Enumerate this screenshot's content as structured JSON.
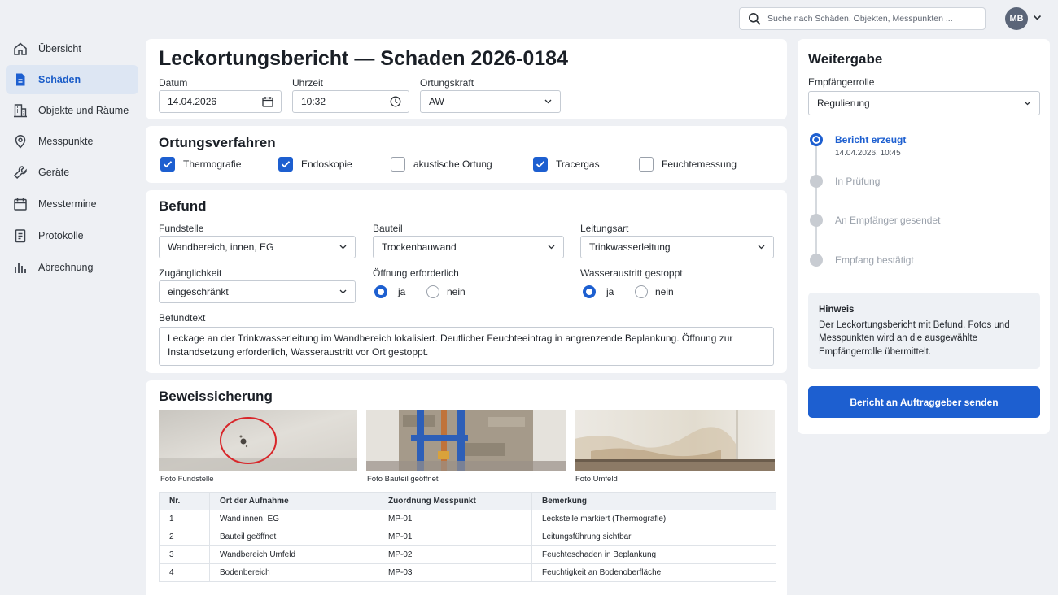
{
  "sidebar": {
    "items": [
      {
        "label": "Übersicht",
        "icon": "home-icon"
      },
      {
        "label": "Schäden",
        "icon": "document-icon",
        "active": true
      },
      {
        "label": "Objekte und Räume",
        "icon": "building-icon"
      },
      {
        "label": "Messpunkte",
        "icon": "map-pin-icon"
      },
      {
        "label": "Geräte",
        "icon": "wrench-icon"
      },
      {
        "label": "Messtermine",
        "icon": "calendar-icon"
      },
      {
        "label": "Protokolle",
        "icon": "clipboard-icon"
      },
      {
        "label": "Abrechnung",
        "icon": "bar-chart-icon"
      }
    ]
  },
  "topbar": {
    "search_placeholder": "Suche nach Schäden, Objekten, Messpunkten ...",
    "avatar_initials": "MB"
  },
  "report": {
    "title": "Leckortungsbericht — Schaden 2026-0184",
    "date_label": "Datum",
    "date_value": "14.04.2026",
    "time_label": "Uhrzeit",
    "time_value": "10:32",
    "technician_label": "Ortungskraft",
    "technician_value": "AW"
  },
  "methods": {
    "title": "Ortungsverfahren",
    "options": [
      {
        "label": "Thermografie",
        "checked": true
      },
      {
        "label": "Endoskopie",
        "checked": true
      },
      {
        "label": "akustische Ortung",
        "checked": false
      },
      {
        "label": "Tracergas",
        "checked": true
      },
      {
        "label": "Feuchtemessung",
        "checked": false
      }
    ]
  },
  "finding": {
    "title": "Befund",
    "location_label": "Fundstelle",
    "location_value": "Wandbereich, innen, EG",
    "component_label": "Bauteil",
    "component_value": "Trockenbauwand",
    "pipe_label": "Leitungsart",
    "pipe_value": "Trinkwasserleitung",
    "access_label": "Zugänglichkeit",
    "access_value": "eingeschränkt",
    "opening_label": "Öffnung erforderlich",
    "opening_yes": "ja",
    "opening_no": "nein",
    "opening_value": "ja",
    "water_label": "Wasseraustritt gestoppt",
    "water_yes": "ja",
    "water_no": "nein",
    "water_value": "ja",
    "text_label": "Befundtext",
    "text_value": "Leckage an der Trinkwasserleitung im Wandbereich lokalisiert. Deutlicher Feuchteeintrag in angrenzende Beplankung. Öffnung zur Instandsetzung erforderlich, Wasseraustritt vor Ort gestoppt."
  },
  "evidence": {
    "title": "Beweissicherung",
    "photos": [
      {
        "caption": "Foto Fundstelle"
      },
      {
        "caption": "Foto Bauteil geöffnet"
      },
      {
        "caption": "Foto Umfeld"
      }
    ],
    "table": {
      "headers": [
        "Nr.",
        "Ort der Aufnahme",
        "Zuordnung Messpunkt",
        "Bemerkung"
      ],
      "rows": [
        [
          "1",
          "Wand innen, EG",
          "MP-01",
          "Leckstelle markiert (Thermografie)"
        ],
        [
          "2",
          "Bauteil geöffnet",
          "MP-01",
          "Leitungsführung sichtbar"
        ],
        [
          "3",
          "Wandbereich Umfeld",
          "MP-02",
          "Feuchteschaden in Beplankung"
        ],
        [
          "4",
          "Bodenbereich",
          "MP-03",
          "Feuchtigkeit an Bodenoberfläche"
        ]
      ]
    }
  },
  "forward": {
    "title": "Weitergabe",
    "recipient_label": "Empfängerrolle",
    "recipient_value": "Regulierung",
    "steps": [
      {
        "title": "Bericht erzeugt",
        "sub": "14.04.2026, 10:45",
        "state": "active"
      },
      {
        "title": "In Prüfung",
        "sub": "",
        "state": "pending"
      },
      {
        "title": "An Empfänger gesendet",
        "sub": "",
        "state": "pending"
      },
      {
        "title": "Empfang bestätigt",
        "sub": "",
        "state": "pending"
      }
    ],
    "hint_title": "Hinweis",
    "hint_text": "Der Leckortungsbericht mit Befund, Fotos und Messpunkten wird an die ausgewählte Empfängerrolle übermittelt.",
    "send_button": "Bericht an Auftraggeber senden"
  },
  "colors": {
    "accent": "#1d5fd0",
    "background": "#eef0f4",
    "nav_active_bg": "#dde6f3",
    "pending": "#c8ccd2"
  }
}
